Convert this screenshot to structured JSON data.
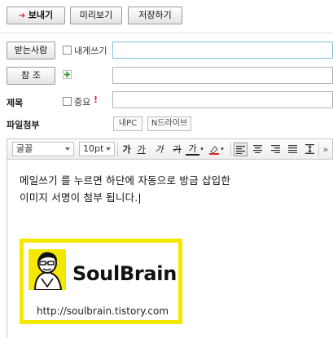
{
  "top_buttons": {
    "send": "보내기",
    "preview": "미리보기",
    "save": "저장하기"
  },
  "recipients": {
    "to_button": "받는사람",
    "to_me_label": "내게쓰기",
    "to_value": "",
    "cc_button": "참 조",
    "cc_value": ""
  },
  "subject": {
    "label": "제목",
    "important_label": "중요",
    "important_mark": "!",
    "value": ""
  },
  "attachment": {
    "label": "파일첨부",
    "my_pc": "내PC",
    "n_drive": "N드라이브"
  },
  "toolbar": {
    "font": "굴꼴",
    "size": "10pt",
    "bold": "가",
    "underline": "가",
    "italic": "가",
    "strike": "가",
    "color": "가",
    "more": "»"
  },
  "editor": {
    "line1": "메일쓰기 를 누르면 하단에 자동으로 방금 삽입한",
    "line2": "이미지 서명이 첨부 됩니다.|"
  },
  "signature": {
    "brand": "SoulBrain",
    "url": "http://soulbrain.tistory.com",
    "frame_color": "#f4e800"
  },
  "colors": {
    "send_arrow": "#e0242b",
    "important_mark": "#e0242b",
    "plus_icon": "#2f9e2f",
    "active_field_border": "#7fc4de"
  }
}
